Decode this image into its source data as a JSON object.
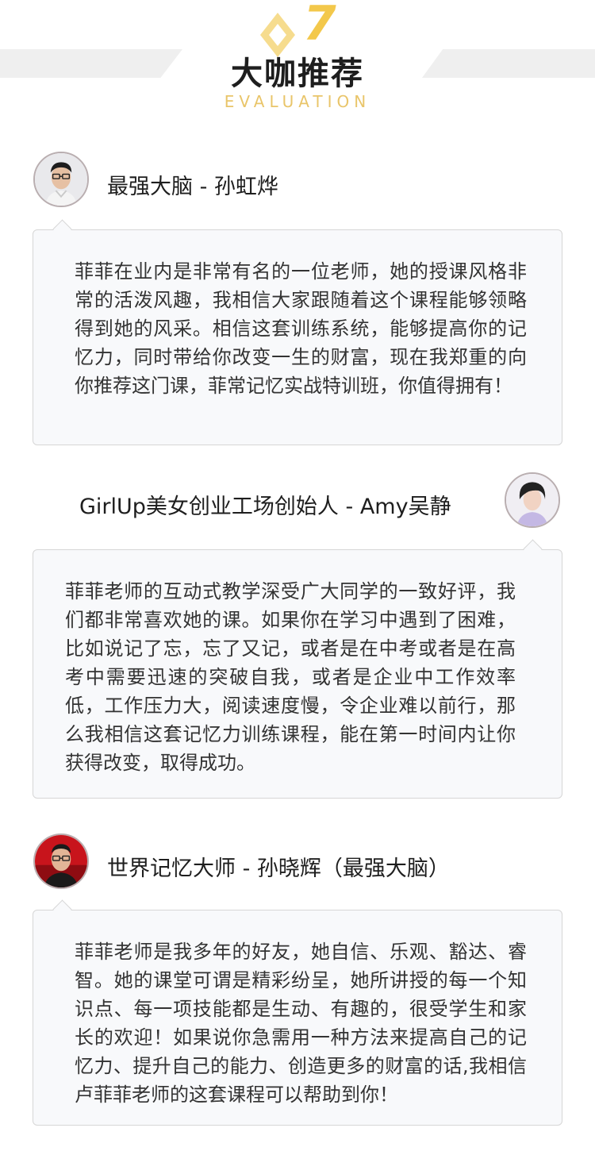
{
  "header": {
    "badge_number": "7",
    "title": "大咖推荐",
    "subtitle": "EVALUATION",
    "accent_color": "#f3c84b",
    "band_color": "#efefef"
  },
  "reviews": [
    {
      "name": "最强大脑 - 孙虹烨",
      "avatar_side": "left",
      "text": "菲菲在业内是非常有名的一位老师，她的授课风格非常的活泼风趣，我相信大家跟随着这个课程能够领略得到她的风采。相信这套训练系统，能够提高你的记忆力，同时带给你改变一生的财富，现在我郑重的向你推荐这门课，菲常记忆实战特训班，你值得拥有！"
    },
    {
      "name": "GirlUp美女创业工场创始人 - Amy吴静",
      "avatar_side": "right",
      "text": "菲菲老师的互动式教学深受广大同学的一致好评，我们都非常喜欢她的课。如果你在学习中遇到了困难，比如说记了忘，忘了又记，或者是在中考或者是在高考中需要迅速的突破自我，或者是企业中工作效率低，工作压力大，阅读速度慢，令企业难以前行，那么我相信这套记忆力训练课程，能在第一时间内让你获得改变，取得成功。"
    },
    {
      "name": "世界记忆大师 - 孙晓辉（最强大脑）",
      "avatar_side": "left",
      "text": "菲菲老师是我多年的好友，她自信、乐观、豁达、睿智。她的课堂可谓是精彩纷呈，她所讲授的每一个知识点、每一项技能都是生动、有趣的，很受学生和家长的欢迎！如果说你急需用一种方法来提高自己的记忆力、提升自己的能力、创造更多的财富的话,我相信卢菲菲老师的这套课程可以帮助到你！"
    }
  ]
}
